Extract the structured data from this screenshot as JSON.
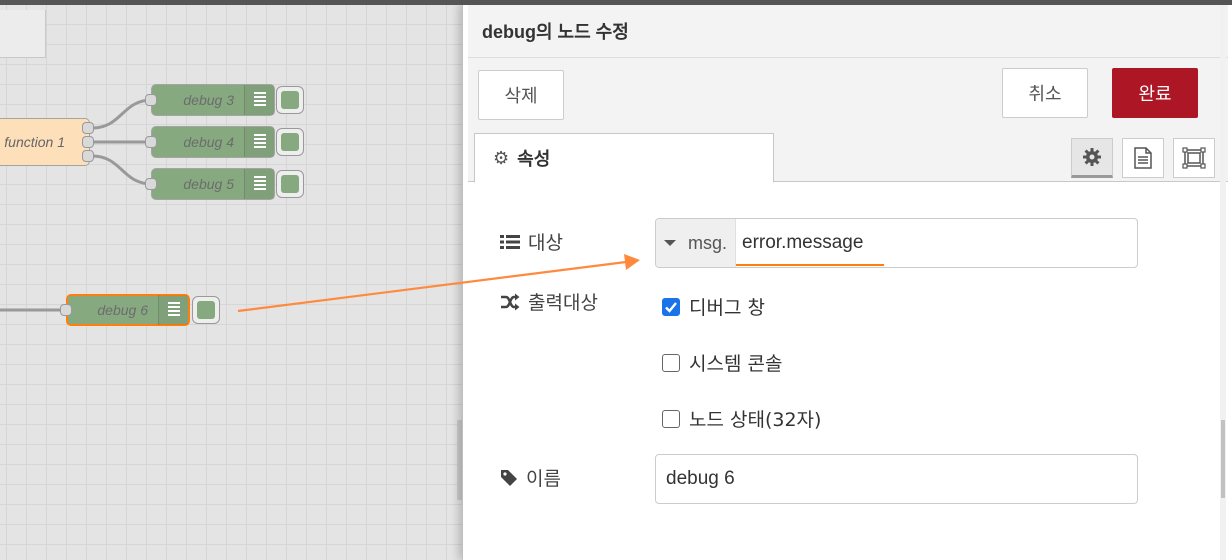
{
  "canvas": {
    "nodes": {
      "function1": "function 1",
      "debug3": "debug 3",
      "debug4": "debug 4",
      "debug5": "debug 5",
      "debug6": "debug 6"
    }
  },
  "tray": {
    "title": "debug의 노드 수정",
    "delete_label": "삭제",
    "cancel_label": "취소",
    "done_label": "완료",
    "tab_properties": "속성"
  },
  "form": {
    "property_label": "대상",
    "property_type": "msg.",
    "property_value": "error.message",
    "output_label": "출력대상",
    "output_options": [
      {
        "label": "디버그 창",
        "checked": true
      },
      {
        "label": "시스템 콘솔",
        "checked": false
      },
      {
        "label": "노드 상태(32자)",
        "checked": false
      }
    ],
    "name_label": "이름",
    "name_value": "debug 6"
  },
  "colors": {
    "accent": "#ad1625",
    "highlight": "#ff7f0e",
    "checkbox": "#1a73e8",
    "debug_node": "#87a980",
    "function_node": "#fddfb9"
  }
}
